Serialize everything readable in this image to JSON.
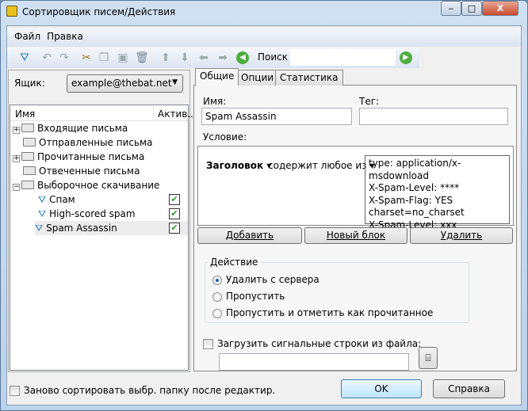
{
  "window": {
    "title": "Сортировщик писем/Действия",
    "minimize": "‒",
    "maximize": "□",
    "close": "X"
  },
  "menu": {
    "file": "Файл",
    "edit": "Правка"
  },
  "toolbar": {
    "search_label": "Поиск",
    "search_value": ""
  },
  "left": {
    "mailbox_label": "Ящик:",
    "mailbox_value": "example@thebat.net",
    "col_name": "Имя",
    "col_active": "Актив...",
    "tree": [
      {
        "label": "Входящие письма",
        "type": "folder",
        "expander": "+"
      },
      {
        "label": "Отправленные письма",
        "type": "folder",
        "expander": ""
      },
      {
        "label": "Прочитанные письма",
        "type": "folder",
        "expander": "+"
      },
      {
        "label": "Отвеченные письма",
        "type": "folder",
        "expander": ""
      },
      {
        "label": "Выборочное скачивание",
        "type": "folder",
        "expander": "−"
      },
      {
        "label": "Спам",
        "type": "filter",
        "active": true
      },
      {
        "label": "High-scored spam",
        "type": "filter",
        "active": true
      },
      {
        "label": "Spam Assassin",
        "type": "filter",
        "active": true,
        "selected": true
      }
    ]
  },
  "tabs": [
    "Общие",
    "Опции",
    "Статистика"
  ],
  "general": {
    "name_label": "Имя:",
    "name_value": "Spam Assassin",
    "tag_label": "Тег:",
    "tag_value": "",
    "condition_label": "Условие:",
    "cond_field": "Заголовок",
    "cond_op": "содержит любое из",
    "cond_values": [
      "type: application/x-msdownload",
      "X-Spam-Level: ****",
      "X-Spam-Flag: YES",
      "charset=no_charset",
      "X-Spam-Level: xxx"
    ],
    "add": "Добавить",
    "new_block": "Новый блок",
    "delete": "Удалить",
    "action_label": "Действие",
    "actions": [
      {
        "label": "Удалить с сервера",
        "selected": true
      },
      {
        "label": "Пропустить",
        "selected": false
      },
      {
        "label": "Пропустить и отметить как прочитанное",
        "selected": false
      }
    ],
    "load_label": "Загрузить сигнальные строки из файла:",
    "load_checked": false,
    "load_path": ""
  },
  "bottom": {
    "resort_label": "Заново сортировать выбр. папку после редактир.",
    "resort_checked": false,
    "ok": "OK",
    "help": "Справка"
  }
}
